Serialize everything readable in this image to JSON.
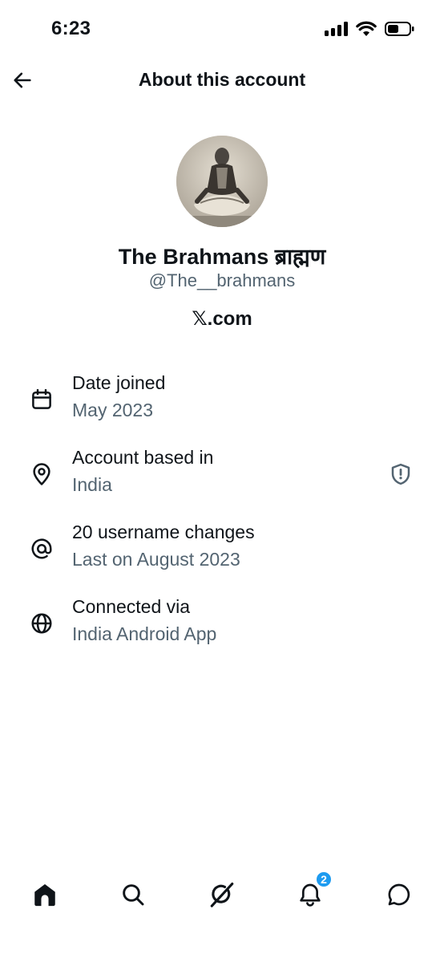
{
  "status_bar": {
    "time": "6:23"
  },
  "header": {
    "title": "About this account"
  },
  "profile": {
    "display_name": "The Brahmans ब्राह्मण",
    "handle": "@The__brahmans",
    "site": "𝕏.com"
  },
  "info": {
    "date_joined": {
      "title": "Date joined",
      "value": "May 2023",
      "icon": "calendar-icon"
    },
    "account_based": {
      "title": "Account based in",
      "value": "India",
      "icon": "location-pin-icon",
      "badge_icon": "shield-alert-icon"
    },
    "username_changes": {
      "title": "20 username changes",
      "value": "Last on August 2023",
      "icon": "at-sign-icon"
    },
    "connected_via": {
      "title": "Connected via",
      "value": "India Android App",
      "icon": "globe-icon"
    }
  },
  "nav": {
    "notifications_count": "2",
    "items": [
      "home-icon",
      "search-icon",
      "grok-icon",
      "bell-icon",
      "messages-icon"
    ]
  },
  "colors": {
    "text": "#0f1419",
    "secondary": "#536471",
    "accent": "#1d9bf0"
  }
}
